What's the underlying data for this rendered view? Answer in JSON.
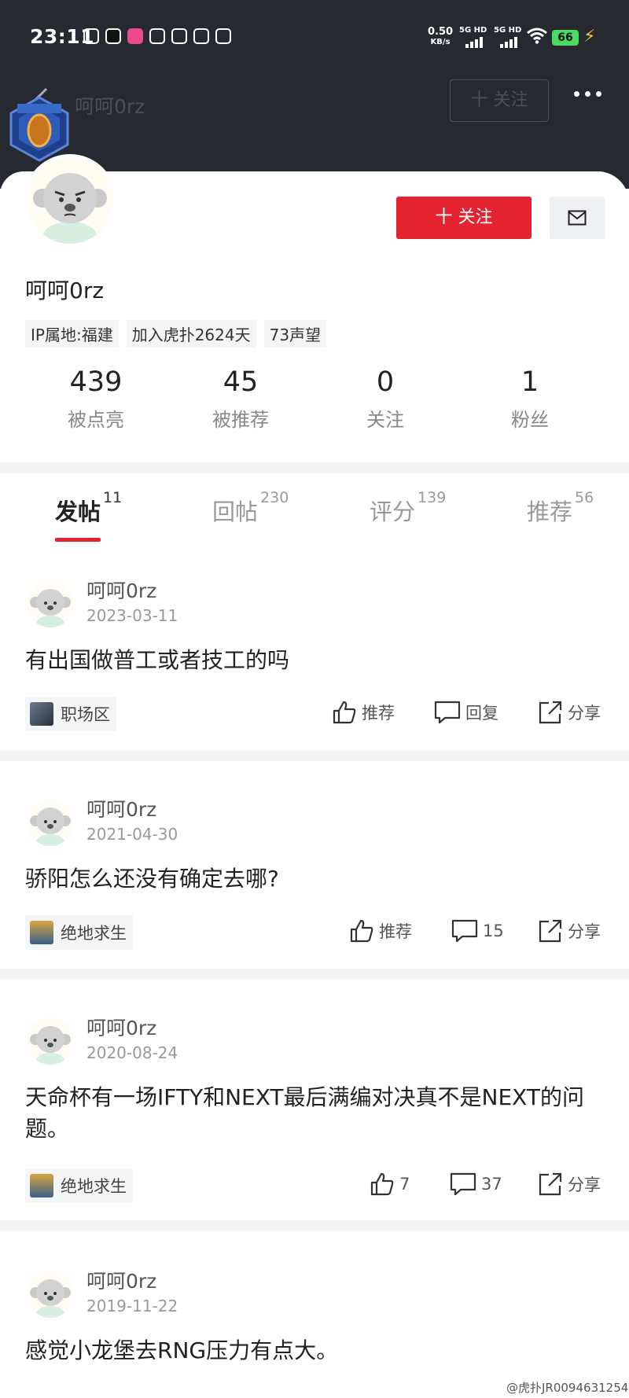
{
  "status_bar": {
    "time": "23:11",
    "net_speed": "0.50",
    "net_unit": "KB/s",
    "sim1": "5G HD",
    "sim2": "5G HD",
    "battery": "66"
  },
  "nav": {
    "username": "呵呵0rz",
    "follow_label": "十 关注"
  },
  "profile": {
    "follow_button": "十 关注",
    "name": "呵呵0rz",
    "tags": [
      "IP属地:福建",
      "加入虎扑2624天",
      "73声望"
    ],
    "stats": [
      {
        "value": "439",
        "label": "被点亮"
      },
      {
        "value": "45",
        "label": "被推荐"
      },
      {
        "value": "0",
        "label": "关注"
      },
      {
        "value": "1",
        "label": "粉丝"
      }
    ]
  },
  "tabs": [
    {
      "label": "发帖",
      "count": "11"
    },
    {
      "label": "回帖",
      "count": "230"
    },
    {
      "label": "评分",
      "count": "139"
    },
    {
      "label": "推荐",
      "count": "56"
    }
  ],
  "posts": [
    {
      "author": "呵呵0rz",
      "date": "2023-03-11",
      "title": "有出国做普工或者技工的吗",
      "board": "职场区",
      "recommend": "推荐",
      "reply": "回复",
      "share": "分享"
    },
    {
      "author": "呵呵0rz",
      "date": "2021-04-30",
      "title": "骄阳怎么还没有确定去哪?",
      "board": "绝地求生",
      "recommend": "推荐",
      "reply": "15",
      "share": "分享"
    },
    {
      "author": "呵呵0rz",
      "date": "2020-08-24",
      "title": "天命杯有一场IFTY和NEXT最后满编对决真不是NEXT的问题。",
      "board": "绝地求生",
      "recommend": "7",
      "reply": "37",
      "share": "分享"
    },
    {
      "author": "呵呵0rz",
      "date": "2019-11-22",
      "title": "感觉小龙堡去RNG压力有点大。"
    }
  ],
  "watermark": "@虎扑JR0094631254",
  "colors": {
    "header_bg": "#262a30",
    "accent_red": "#e3232f",
    "battery_green": "#4cd964"
  }
}
